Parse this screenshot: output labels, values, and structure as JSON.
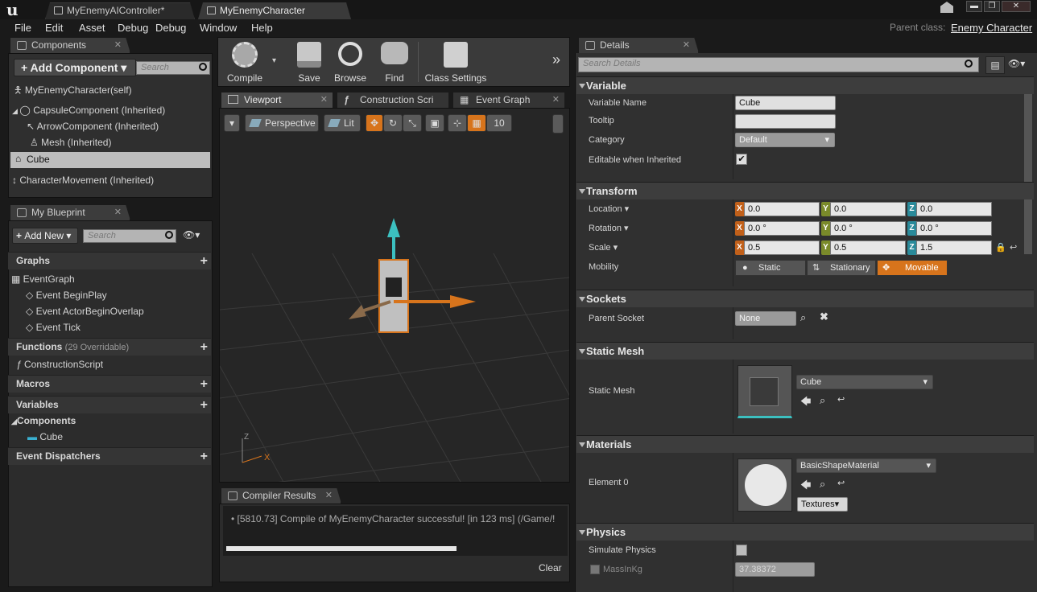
{
  "window": {
    "tabs": [
      {
        "label": "MyEnemyAIController*"
      },
      {
        "label": "MyEnemyCharacter"
      }
    ],
    "controls": {
      "min": "▬",
      "max": "❐",
      "close": "✕"
    }
  },
  "menu": {
    "items": [
      "File",
      "Edit",
      "Asset",
      "Debug",
      "Window",
      "Help"
    ],
    "parent_class_label": "Parent class:",
    "parent_class_value": "Enemy Character"
  },
  "components_panel": {
    "tab": "Components",
    "add_label": "Add Component",
    "search_placeholder": "Search",
    "tree": [
      {
        "label": "MyEnemyCharacter(self)"
      },
      {
        "label": "CapsuleComponent (Inherited)"
      },
      {
        "label": "ArrowComponent (Inherited)"
      },
      {
        "label": "Mesh (Inherited)"
      },
      {
        "label": "Cube"
      },
      {
        "label": "CharacterMovement (Inherited)"
      }
    ]
  },
  "blueprint_panel": {
    "tab": "My Blueprint",
    "add_new": "Add New",
    "search_placeholder": "Search",
    "graphs": "Graphs",
    "event_graph": "EventGraph",
    "events": [
      "Event BeginPlay",
      "Event ActorBeginOverlap",
      "Event Tick"
    ],
    "functions": "Functions",
    "functions_note": "(29 Overridable)",
    "construction_script": "ConstructionScript",
    "macros": "Macros",
    "variables": "Variables",
    "components": "Components",
    "cube": "Cube",
    "event_dispatchers": "Event Dispatchers"
  },
  "toolbar": {
    "compile": "Compile",
    "save": "Save",
    "browse": "Browse",
    "find": "Find",
    "class_settings": "Class Settings"
  },
  "viewport_tabs": {
    "viewport": "Viewport",
    "construction": "Construction Scri",
    "event_graph": "Event Graph"
  },
  "viewport": {
    "perspective": "Perspective",
    "lit": "Lit",
    "grid_snap": "10",
    "axis_x": "X",
    "axis_z": "Z"
  },
  "compiler": {
    "tab": "Compiler Results",
    "message": "[5810.73] Compile of MyEnemyCharacter successful! [in 123 ms] (/Game/!",
    "clear": "Clear"
  },
  "details": {
    "tab": "Details",
    "search_placeholder": "Search Details",
    "variable": {
      "header": "Variable",
      "name_label": "Variable Name",
      "name_value": "Cube",
      "tooltip_label": "Tooltip",
      "tooltip_value": "",
      "category_label": "Category",
      "category_value": "Default",
      "editable_label": "Editable when Inherited",
      "editable": "✔"
    },
    "transform": {
      "header": "Transform",
      "location_label": "Location",
      "location": [
        "0.0",
        "0.0",
        "0.0"
      ],
      "rotation_label": "Rotation",
      "rotation": [
        "0.0 °",
        "0.0 °",
        "0.0 °"
      ],
      "scale_label": "Scale",
      "scale": [
        "0.5",
        "0.5",
        "1.5"
      ],
      "mobility_label": "Mobility",
      "mobility_options": [
        "Static",
        "Stationary",
        "Movable"
      ],
      "mobility_selected": "Movable"
    },
    "sockets": {
      "header": "Sockets",
      "parent_label": "Parent Socket",
      "parent_value": "None"
    },
    "static_mesh": {
      "header": "Static Mesh",
      "label": "Static Mesh",
      "value": "Cube"
    },
    "materials": {
      "header": "Materials",
      "label": "Element 0",
      "value": "BasicShapeMaterial",
      "textures": "Textures"
    },
    "physics": {
      "header": "Physics",
      "simulate_label": "Simulate Physics",
      "mass_label": "MassInKg",
      "mass_value": "37.38372"
    }
  },
  "colors": {
    "accent_orange": "#d7741c",
    "axis_green": "#3cc0c0"
  }
}
